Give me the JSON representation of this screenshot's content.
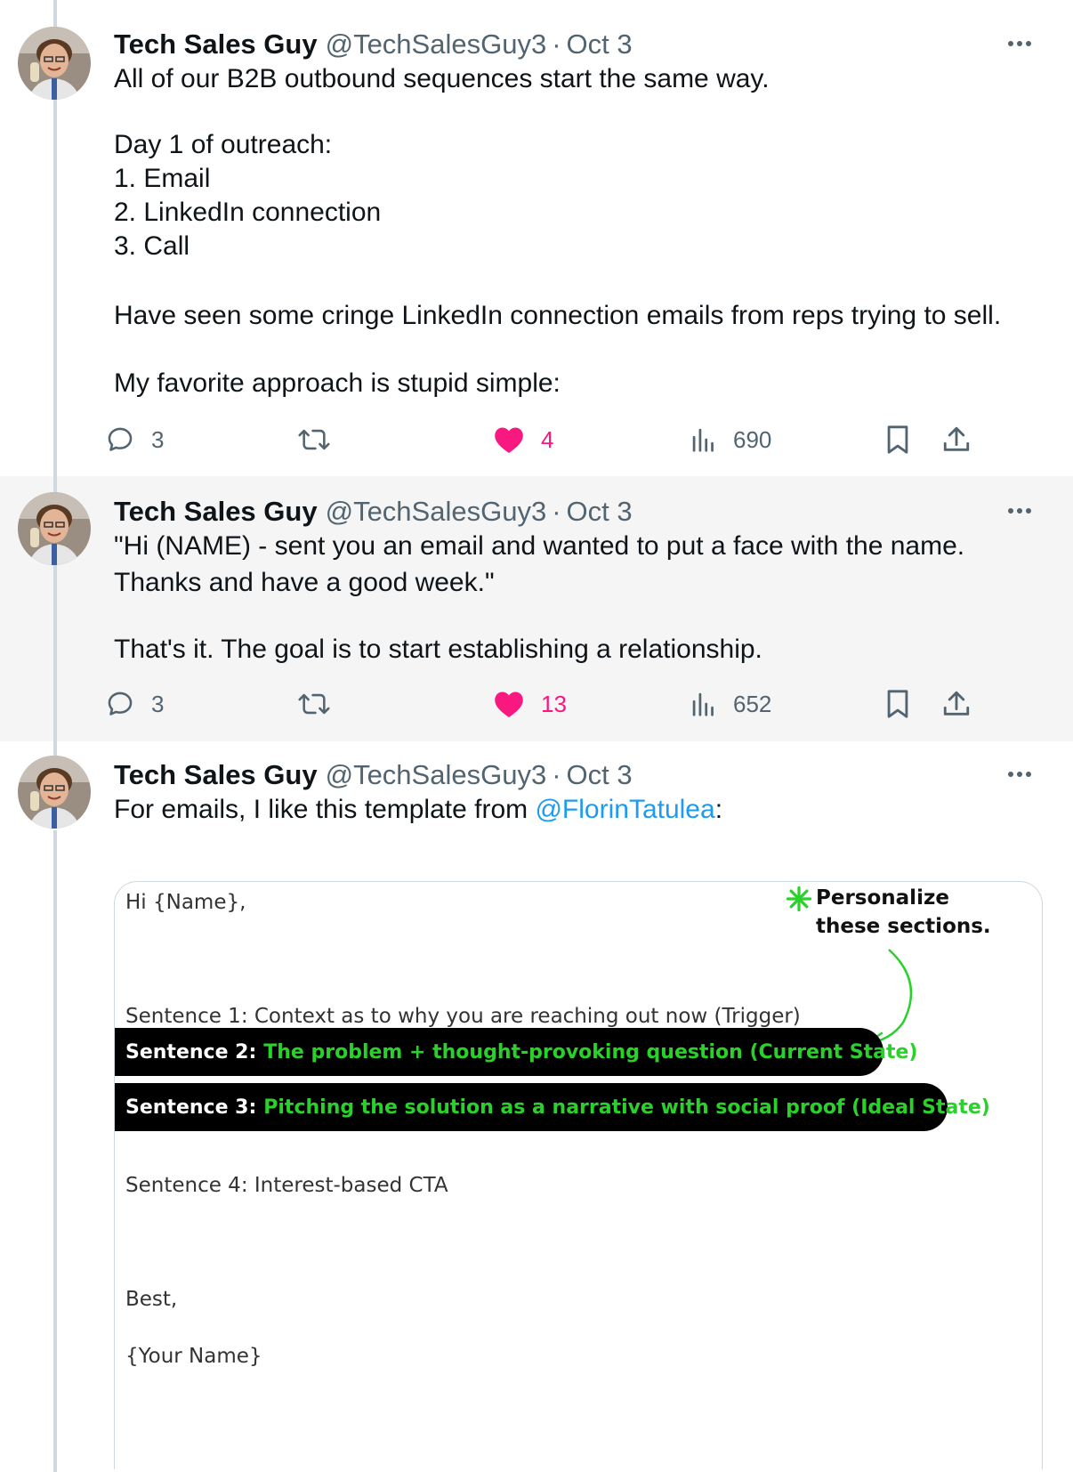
{
  "tweets": [
    {
      "name": "Tech Sales Guy",
      "handle": "@TechSalesGuy3",
      "separator": "·",
      "date": "Oct 3",
      "lines": [
        "All of our B2B outbound sequences start the same way.",
        "",
        "Day 1 of outreach:",
        "1. Email",
        "2. LinkedIn connection",
        "3. Call",
        "",
        "Have seen some cringe LinkedIn connection emails from reps trying to sell.",
        "",
        "My favorite approach is stupid simple:"
      ],
      "replies": "3",
      "likes": "4",
      "views": "690",
      "liked": true
    },
    {
      "name": "Tech Sales Guy",
      "handle": "@TechSalesGuy3",
      "separator": "·",
      "date": "Oct 3",
      "lines": [
        "\"Hi (NAME) - sent you an email and wanted to put a face with the name.",
        "Thanks and have a good week.\"",
        "",
        "That's it. The goal is to start establishing a relationship."
      ],
      "replies": "3",
      "likes": "13",
      "views": "652",
      "liked": true
    },
    {
      "name": "Tech Sales Guy",
      "handle": "@TechSalesGuy3",
      "separator": "·",
      "date": "Oct 3",
      "text_before_mention": "For emails, I like this template from ",
      "mention": "@FlorinTatulea",
      "text_after_mention": ":"
    }
  ],
  "media": {
    "greeting": "Hi {Name},",
    "callout": "Personalize these sections.",
    "sentence1": "Sentence 1: Context as to why you are reaching out now (Trigger)",
    "sentence2_lead": "Sentence 2:",
    "sentence2_rest": "The problem + thought-provoking question (Current State)",
    "sentence3_lead": "Sentence 3:",
    "sentence3_rest": "Pitching the solution as a narrative with social proof (Ideal State)",
    "sentence4": "Sentence 4: Interest-based CTA",
    "signoff": "Best,",
    "signature": "{Your Name}"
  },
  "icons": [
    "reply-icon",
    "retweet-icon",
    "heart-icon",
    "views-icon",
    "bookmark-icon",
    "share-icon",
    "more-icon",
    "asterisk-icon",
    "curved-arrow-icon"
  ],
  "colors": {
    "like": "#f91880",
    "link": "#1d9bf0",
    "muted": "#536471",
    "highlight_green": "#2bd12b"
  }
}
